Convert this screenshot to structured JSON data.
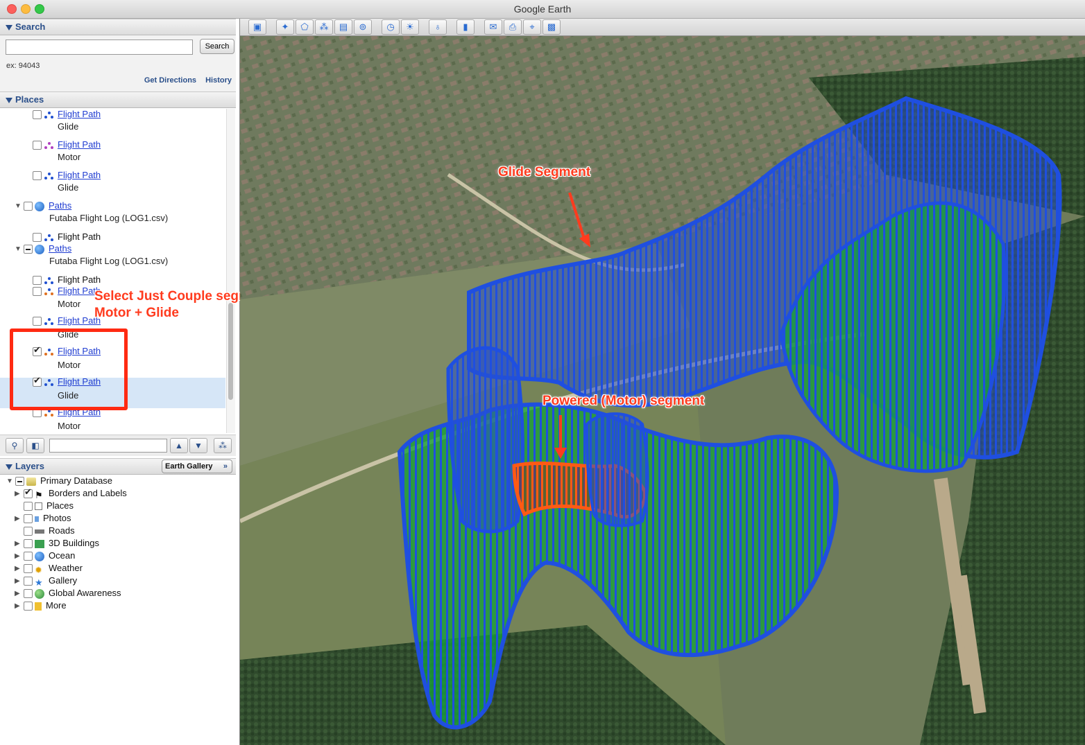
{
  "window": {
    "title": "Google Earth"
  },
  "search": {
    "header": "Search",
    "input_value": "",
    "button": "Search",
    "hint": "ex: 94043",
    "get_directions": "Get Directions",
    "history": "History"
  },
  "places": {
    "header": "Places",
    "items": [
      {
        "label": "Flight Path",
        "sub": "Glide"
      },
      {
        "label": "Flight Path",
        "sub": "Motor"
      },
      {
        "label": "Flight Path",
        "sub": "Glide"
      },
      {
        "label": "Paths",
        "sub": "Futaba Flight Log (LOG1.csv)"
      },
      {
        "label": "Flight Path"
      },
      {
        "label": "Paths",
        "sub": "Futaba Flight Log (LOG1.csv)"
      },
      {
        "label": "Flight Path"
      },
      {
        "label": "Flight Path",
        "sub": "Motor"
      },
      {
        "label": "Flight Path",
        "sub": "Glide"
      },
      {
        "label": "Flight Path",
        "sub": "Motor"
      },
      {
        "label": "Flight Path",
        "sub": "Glide"
      },
      {
        "label": "Flight Path",
        "sub": "Motor"
      }
    ],
    "annotation_line1": "Select Just Couple segments",
    "annotation_line2": "Motor + Glide"
  },
  "layers": {
    "header": "Layers",
    "gallery_button": "Earth Gallery",
    "gallery_chevron": "»",
    "items": [
      {
        "label": "Primary Database"
      },
      {
        "label": "Borders and Labels"
      },
      {
        "label": "Places"
      },
      {
        "label": "Photos"
      },
      {
        "label": "Roads"
      },
      {
        "label": "3D Buildings"
      },
      {
        "label": "Ocean"
      },
      {
        "label": "Weather"
      },
      {
        "label": "Gallery"
      },
      {
        "label": "Global Awareness"
      },
      {
        "label": "More"
      }
    ]
  },
  "map": {
    "glide_label": "Glide Segment",
    "motor_label": "Powered (Motor) segment"
  },
  "colors": {
    "glide": "#1f4fe0",
    "motor": "#ff5a14",
    "fill_green": "#1aa33a",
    "annotation": "#ff3b1e"
  }
}
